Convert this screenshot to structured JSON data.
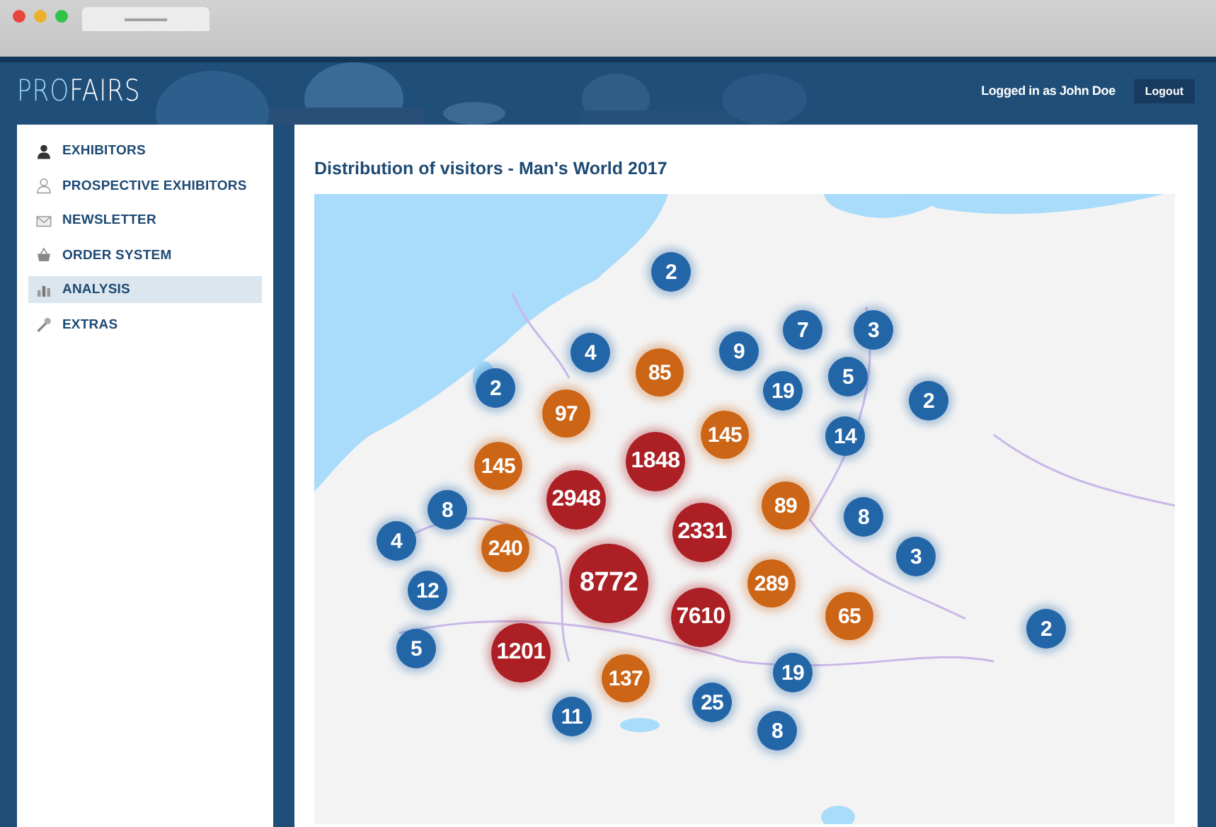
{
  "header": {
    "logo": {
      "prefix": "PRO",
      "suffix": "FAIRS"
    },
    "user_label": "Logged in as John Doe",
    "logout_button": "Logout"
  },
  "sidebar": {
    "items": [
      {
        "label": "EXHIBITORS",
        "kind": "person",
        "selected": false
      },
      {
        "label": "PROSPECTIVE EXHIBITORS",
        "kind": "person-outline",
        "selected": false
      },
      {
        "label": "NEWSLETTER",
        "kind": "envelope",
        "selected": false
      },
      {
        "label": "ORDER SYSTEM",
        "kind": "basket",
        "selected": false
      },
      {
        "label": "ANALYSIS",
        "kind": "chart",
        "selected": true
      },
      {
        "label": "EXTRAS",
        "kind": "wrench",
        "selected": false
      }
    ]
  },
  "main": {
    "title": "Distribution of visitors - Man's World 2017",
    "map": {
      "clusters": [
        {
          "count": "2",
          "kind": "small"
        },
        {
          "count": "4",
          "kind": "small"
        },
        {
          "count": "85",
          "kind": "medium"
        },
        {
          "count": "9",
          "kind": "small"
        },
        {
          "count": "7",
          "kind": "small"
        },
        {
          "count": "3",
          "kind": "small"
        },
        {
          "count": "2",
          "kind": "small"
        },
        {
          "count": "97",
          "kind": "medium"
        },
        {
          "count": "19",
          "kind": "small"
        },
        {
          "count": "5",
          "kind": "small"
        },
        {
          "count": "2",
          "kind": "small"
        },
        {
          "count": "145",
          "kind": "medium"
        },
        {
          "count": "14",
          "kind": "small"
        },
        {
          "count": "145",
          "kind": "medium"
        },
        {
          "count": "1848",
          "kind": "large"
        },
        {
          "count": "2948",
          "kind": "large"
        },
        {
          "count": "89",
          "kind": "medium"
        },
        {
          "count": "8",
          "kind": "small"
        },
        {
          "count": "8",
          "kind": "small"
        },
        {
          "count": "4",
          "kind": "small"
        },
        {
          "count": "240",
          "kind": "medium"
        },
        {
          "count": "2331",
          "kind": "large"
        },
        {
          "count": "3",
          "kind": "small"
        },
        {
          "count": "8772",
          "kind": "large"
        },
        {
          "count": "289",
          "kind": "medium"
        },
        {
          "count": "12",
          "kind": "small"
        },
        {
          "count": "7610",
          "kind": "large"
        },
        {
          "count": "65",
          "kind": "medium"
        },
        {
          "count": "2",
          "kind": "small"
        },
        {
          "count": "5",
          "kind": "small"
        },
        {
          "count": "1201",
          "kind": "large"
        },
        {
          "count": "19",
          "kind": "small"
        },
        {
          "count": "137",
          "kind": "medium"
        },
        {
          "count": "25",
          "kind": "small"
        },
        {
          "count": "11",
          "kind": "small"
        },
        {
          "count": "8",
          "kind": "small"
        }
      ]
    }
  }
}
